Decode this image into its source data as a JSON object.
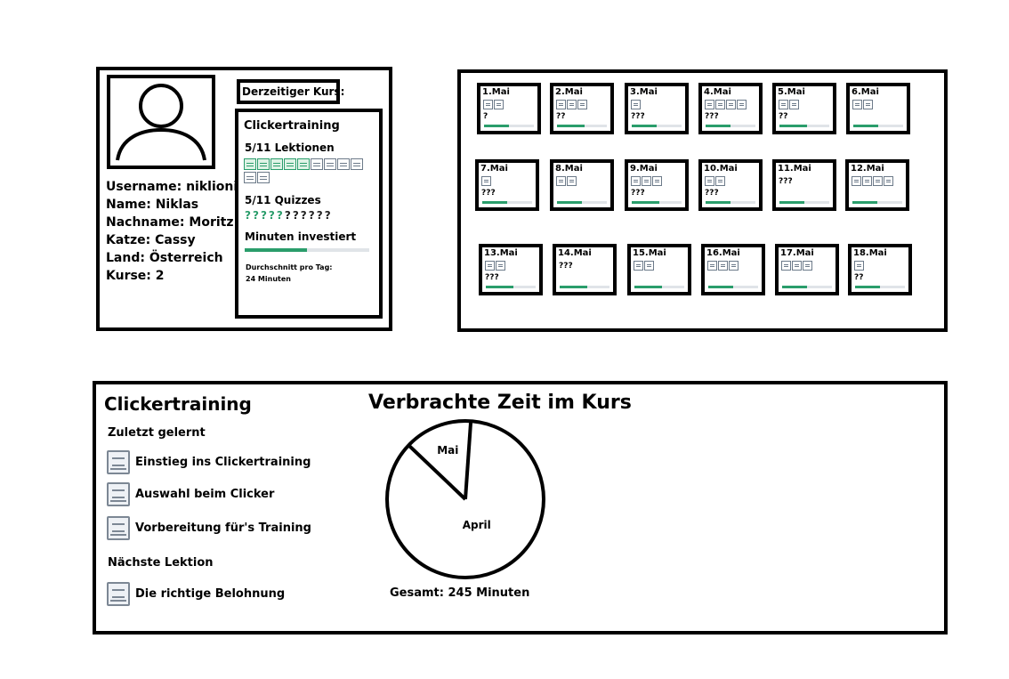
{
  "profile": {
    "username": "Username: niklioni",
    "name": "Name: Niklas",
    "lastname": "Nachname: Moritz",
    "cat": "Katze: Cassy",
    "country": "Land: Österreich",
    "courses": "Kurse: 2"
  },
  "current_course": {
    "header": "Derzeitiger Kurs:",
    "name": "Clickertraining",
    "lessons_label": "5/11 Lektionen",
    "lessons_done": 5,
    "lessons_total": 11,
    "quizzes_label": "5/11 Quizzes",
    "quizzes_done": 5,
    "quizzes_total": 11,
    "quiz_mark": "?",
    "minutes_label": "Minuten investiert",
    "minutes_progress": 0.5,
    "avg_label": "Durchschnitt pro Tag:",
    "avg_value": "24 Minuten"
  },
  "calendar": {
    "days": [
      {
        "label": "1.Mai",
        "icons": 2,
        "q": "?",
        "progress": 0.5
      },
      {
        "label": "2.Mai",
        "icons": 3,
        "q": "??",
        "progress": 0.55
      },
      {
        "label": "3.Mai",
        "icons": 1,
        "q": "???",
        "progress": 0.5
      },
      {
        "label": "4.Mai",
        "icons": 4,
        "q": "???",
        "progress": 0.5
      },
      {
        "label": "5.Mai",
        "icons": 2,
        "q": "??",
        "progress": 0.55
      },
      {
        "label": "6.Mai",
        "icons": 2,
        "q": "",
        "progress": 0.5
      },
      {
        "label": "7.Mai",
        "icons": 1,
        "q": "???",
        "progress": 0.5
      },
      {
        "label": "8.Mai",
        "icons": 2,
        "q": "",
        "progress": 0.5
      },
      {
        "label": "9.Mai",
        "icons": 3,
        "q": "???",
        "progress": 0.55
      },
      {
        "label": "10.Mai",
        "icons": 2,
        "q": "???",
        "progress": 0.5
      },
      {
        "label": "11.Mai",
        "icons": 0,
        "q": "???",
        "progress": 0.5
      },
      {
        "label": "12.Mai",
        "icons": 4,
        "q": "",
        "progress": 0.5
      },
      {
        "label": "13.Mai",
        "icons": 2,
        "q": "???",
        "progress": 0.55
      },
      {
        "label": "14.Mai",
        "icons": 0,
        "q": "???",
        "progress": 0.55
      },
      {
        "label": "15.Mai",
        "icons": 2,
        "q": "",
        "progress": 0.55
      },
      {
        "label": "16.Mai",
        "icons": 3,
        "q": "",
        "progress": 0.5
      },
      {
        "label": "17.Mai",
        "icons": 3,
        "q": "",
        "progress": 0.5
      },
      {
        "label": "18.Mai",
        "icons": 1,
        "q": "??",
        "progress": 0.5
      }
    ]
  },
  "detail": {
    "title": "Clickertraining",
    "recent_heading": "Zuletzt gelernt",
    "recent": [
      "Einstieg ins Clickertraining",
      "Auswahl beim Clicker",
      "Vorbereitung für's Training"
    ],
    "next_heading": "Nächste Lektion",
    "next": "Die richtige Belohnung",
    "time_title": "Verbrachte Zeit im Kurs",
    "total": "Gesamt: 245 Minuten"
  },
  "chart_data": {
    "type": "pie",
    "title": "Verbrachte Zeit im Kurs",
    "labels": [
      "April",
      "Mai"
    ],
    "values": [
      0.86,
      0.14
    ]
  },
  "colors": {
    "accent": "#2a9d6b",
    "track": "#e0e4e8",
    "icon": "#6c7a89"
  }
}
